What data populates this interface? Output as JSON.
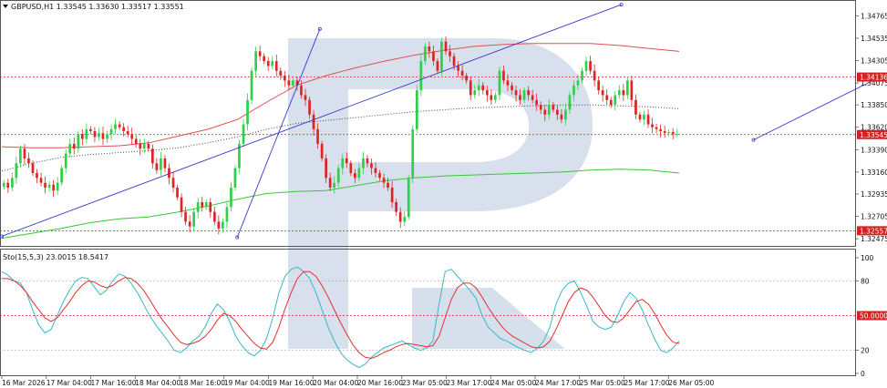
{
  "header": {
    "title": "GBPUSD,H1  1.33545 1.33630 1.33517 1.33551"
  },
  "indicator": {
    "title": "Sto(15,5,3) 23.0015 18.5417"
  },
  "colors": {
    "bull": "#2fcf4a",
    "bear": "#e02424",
    "ma_red": "#e05050",
    "ma_green": "#3ac53a",
    "ma_dotted": "#444444",
    "trendline": "#3a3acc",
    "stoch_main": "#38b7c7",
    "stoch_signal": "#e03030",
    "level_red": "#d42020",
    "watermark": "#c9d6e6"
  },
  "chart_data": [
    {
      "type": "candlestick",
      "symbol": "GBPUSD",
      "timeframe": "H1",
      "y_ticks": [
        "1.34765",
        "1.34535",
        "1.34305",
        "1.34075",
        "1.33850",
        "1.33620",
        "1.33390",
        "1.33160",
        "1.32935",
        "1.32705",
        "1.32475"
      ],
      "ylim": [
        1.3242,
        1.3489
      ],
      "x_ticks": [
        "16 Mar 2026",
        "17 Mar 04:00",
        "17 Mar 16:00",
        "18 Mar 04:00",
        "18 Mar 16:00",
        "19 Mar 04:00",
        "19 Mar 16:00",
        "20 Mar 04:00",
        "20 Mar 16:00",
        "23 Mar 05:00",
        "23 Mar 17:00",
        "24 Mar 05:00",
        "24 Mar 17:00",
        "25 Mar 05:00",
        "25 Mar 17:00",
        "26 Mar 05:00"
      ],
      "price_labels": [
        {
          "text": "1.34136",
          "value": 1.34136
        },
        {
          "text": "1.33545",
          "value": 1.33545
        },
        {
          "text": "1.32557",
          "value": 1.32557
        }
      ],
      "close_series": [
        1.3305,
        1.33,
        1.331,
        1.3325,
        1.334,
        1.333,
        1.3325,
        1.3315,
        1.331,
        1.3305,
        1.33,
        1.3303,
        1.3297,
        1.3305,
        1.332,
        1.3335,
        1.3345,
        1.334,
        1.3355,
        1.335,
        1.336,
        1.3358,
        1.3352,
        1.3356,
        1.335,
        1.3355,
        1.336,
        1.3365,
        1.3362,
        1.3358,
        1.3355,
        1.335,
        1.3345,
        1.334,
        1.3345,
        1.334,
        1.3325,
        1.3318,
        1.333,
        1.332,
        1.331,
        1.33,
        1.329,
        1.3275,
        1.3265,
        1.326,
        1.3275,
        1.3285,
        1.328,
        1.3285,
        1.3275,
        1.3265,
        1.3258,
        1.3265,
        1.328,
        1.33,
        1.332,
        1.3345,
        1.3365,
        1.339,
        1.342,
        1.344,
        1.3435,
        1.343,
        1.3425,
        1.343,
        1.342,
        1.3415,
        1.341,
        1.3405,
        1.341,
        1.3405,
        1.3395,
        1.339,
        1.3375,
        1.336,
        1.3345,
        1.333,
        1.331,
        1.33,
        1.3305,
        1.332,
        1.333,
        1.3325,
        1.3315,
        1.331,
        1.332,
        1.333,
        1.3325,
        1.332,
        1.3315,
        1.331,
        1.3305,
        1.33,
        1.3285,
        1.3275,
        1.3265,
        1.327,
        1.331,
        1.336,
        1.34,
        1.343,
        1.3445,
        1.344,
        1.343,
        1.342,
        1.345,
        1.344,
        1.3435,
        1.3425,
        1.342,
        1.3415,
        1.341,
        1.3395,
        1.34,
        1.3405,
        1.34,
        1.3395,
        1.339,
        1.3395,
        1.342,
        1.341,
        1.3405,
        1.34,
        1.3395,
        1.339,
        1.34,
        1.3395,
        1.339,
        1.3385,
        1.338,
        1.3375,
        1.3385,
        1.338,
        1.3375,
        1.337,
        1.338,
        1.3395,
        1.3405,
        1.341,
        1.342,
        1.343,
        1.342,
        1.341,
        1.34,
        1.3395,
        1.339,
        1.3385,
        1.3395,
        1.34,
        1.3395,
        1.341,
        1.339,
        1.3375,
        1.337,
        1.3375,
        1.3365,
        1.3362,
        1.336,
        1.3358,
        1.3356,
        1.3357,
        1.3355,
        1.3355
      ],
      "ma_red": [
        1.3342,
        1.3341,
        1.3341,
        1.3342,
        1.3343,
        1.3346,
        1.3353,
        1.336,
        1.337,
        1.3388,
        1.3405,
        1.3415,
        1.3423,
        1.343,
        1.3436,
        1.3441,
        1.3445,
        1.3447,
        1.3448,
        1.3448,
        1.3448,
        1.3446,
        1.3443,
        1.344
      ],
      "ma_dotted": [
        1.3317,
        1.3325,
        1.3331,
        1.3334,
        1.3336,
        1.3338,
        1.3341,
        1.3346,
        1.3352,
        1.336,
        1.3366,
        1.3369,
        1.3372,
        1.3375,
        1.3378,
        1.338,
        1.3382,
        1.3383,
        1.3384,
        1.3385,
        1.3385,
        1.3384,
        1.3383,
        1.3381
      ],
      "ma_green": [
        1.3248,
        1.3253,
        1.3258,
        1.3264,
        1.3268,
        1.327,
        1.3275,
        1.3281,
        1.3288,
        1.3294,
        1.3296,
        1.3297,
        1.3302,
        1.3307,
        1.331,
        1.3312,
        1.3313,
        1.3314,
        1.3315,
        1.3316,
        1.3318,
        1.3319,
        1.3318,
        1.3315
      ],
      "trendlines": [
        {
          "points": [
            [
              0,
              1.325
            ],
            [
              150,
              1.3488
            ]
          ]
        },
        {
          "points": [
            [
              57,
              1.3249
            ],
            [
              77,
              1.3463
            ]
          ]
        },
        {
          "points": [
            [
              182,
              1.3349
            ],
            [
              236,
              1.3463
            ]
          ]
        }
      ]
    },
    {
      "type": "line",
      "name": "Sto(15,5,3)",
      "ylim": [
        0,
        100
      ],
      "y_ticks": [
        "100",
        "80",
        "20",
        "0"
      ],
      "level_label": {
        "text": "50.0000",
        "value": 50
      },
      "main": [
        88,
        85,
        80,
        78,
        70,
        55,
        42,
        35,
        38,
        50,
        62,
        72,
        80,
        83,
        82,
        75,
        68,
        72,
        80,
        86,
        84,
        78,
        70,
        60,
        50,
        42,
        35,
        28,
        20,
        18,
        22,
        28,
        32,
        40,
        52,
        60,
        55,
        45,
        32,
        24,
        18,
        15,
        20,
        30,
        48,
        70,
        84,
        90,
        92,
        88,
        82,
        70,
        55,
        40,
        28,
        18,
        12,
        8,
        5,
        8,
        14,
        18,
        22,
        24,
        26,
        28,
        25,
        22,
        20,
        22,
        28,
        60,
        88,
        90,
        84,
        78,
        72,
        65,
        50,
        40,
        35,
        30,
        28,
        25,
        22,
        20,
        18,
        22,
        28,
        40,
        60,
        72,
        78,
        80,
        70,
        58,
        45,
        40,
        38,
        40,
        50,
        62,
        70,
        65,
        55,
        42,
        30,
        20,
        18,
        22,
        28
      ],
      "signal": [
        82,
        82,
        80,
        76,
        70,
        62,
        55,
        48,
        45,
        48,
        55,
        62,
        70,
        76,
        80,
        79,
        76,
        74,
        76,
        80,
        83,
        82,
        78,
        72,
        64,
        55,
        47,
        40,
        33,
        27,
        25,
        26,
        28,
        32,
        38,
        46,
        52,
        50,
        45,
        38,
        32,
        26,
        22,
        21,
        27,
        40,
        56,
        70,
        82,
        88,
        88,
        84,
        76,
        66,
        55,
        44,
        34,
        25,
        18,
        14,
        13,
        15,
        18,
        20,
        23,
        25,
        26,
        25,
        24,
        23,
        24,
        32,
        48,
        64,
        74,
        78,
        78,
        74,
        66,
        57,
        49,
        42,
        36,
        32,
        29,
        26,
        23,
        22,
        23,
        28,
        38,
        50,
        62,
        70,
        74,
        72,
        66,
        58,
        50,
        45,
        44,
        48,
        55,
        62,
        64,
        60,
        52,
        42,
        33,
        27,
        26
      ]
    }
  ]
}
